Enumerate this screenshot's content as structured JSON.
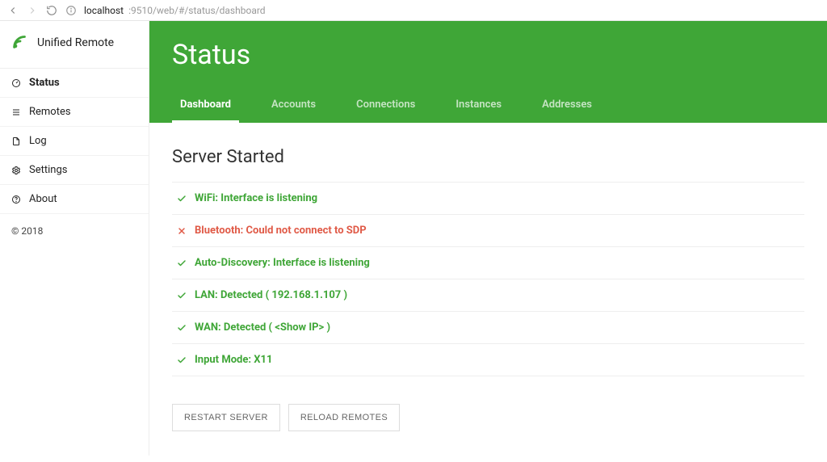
{
  "browser": {
    "url_host": "localhost",
    "url_port_path": ":9510/web/#/status/dashboard"
  },
  "brand": {
    "name": "Unified Remote"
  },
  "sidebar": {
    "items": [
      {
        "label": "Status",
        "icon": "dashboard",
        "active": true
      },
      {
        "label": "Remotes",
        "icon": "list",
        "active": false
      },
      {
        "label": "Log",
        "icon": "file",
        "active": false
      },
      {
        "label": "Settings",
        "icon": "gear",
        "active": false
      },
      {
        "label": "About",
        "icon": "question",
        "active": false
      }
    ],
    "footer": "© 2018"
  },
  "hero": {
    "title": "Status",
    "tabs": [
      {
        "label": "Dashboard",
        "active": true
      },
      {
        "label": "Accounts",
        "active": false
      },
      {
        "label": "Connections",
        "active": false
      },
      {
        "label": "Instances",
        "active": false
      },
      {
        "label": "Addresses",
        "active": false
      }
    ]
  },
  "dashboard": {
    "section_title": "Server Started",
    "status": [
      {
        "ok": true,
        "text": "WiFi: Interface is listening"
      },
      {
        "ok": false,
        "text": "Bluetooth: Could not connect to SDP"
      },
      {
        "ok": true,
        "text": "Auto-Discovery: Interface is listening"
      },
      {
        "ok": true,
        "text": "LAN: Detected ( 192.168.1.107 )"
      },
      {
        "ok": true,
        "text": "WAN: Detected ( <Show IP> )"
      },
      {
        "ok": true,
        "text": "Input Mode: X11"
      }
    ],
    "actions": {
      "restart": "RESTART SERVER",
      "reload": "RELOAD REMOTES"
    }
  }
}
